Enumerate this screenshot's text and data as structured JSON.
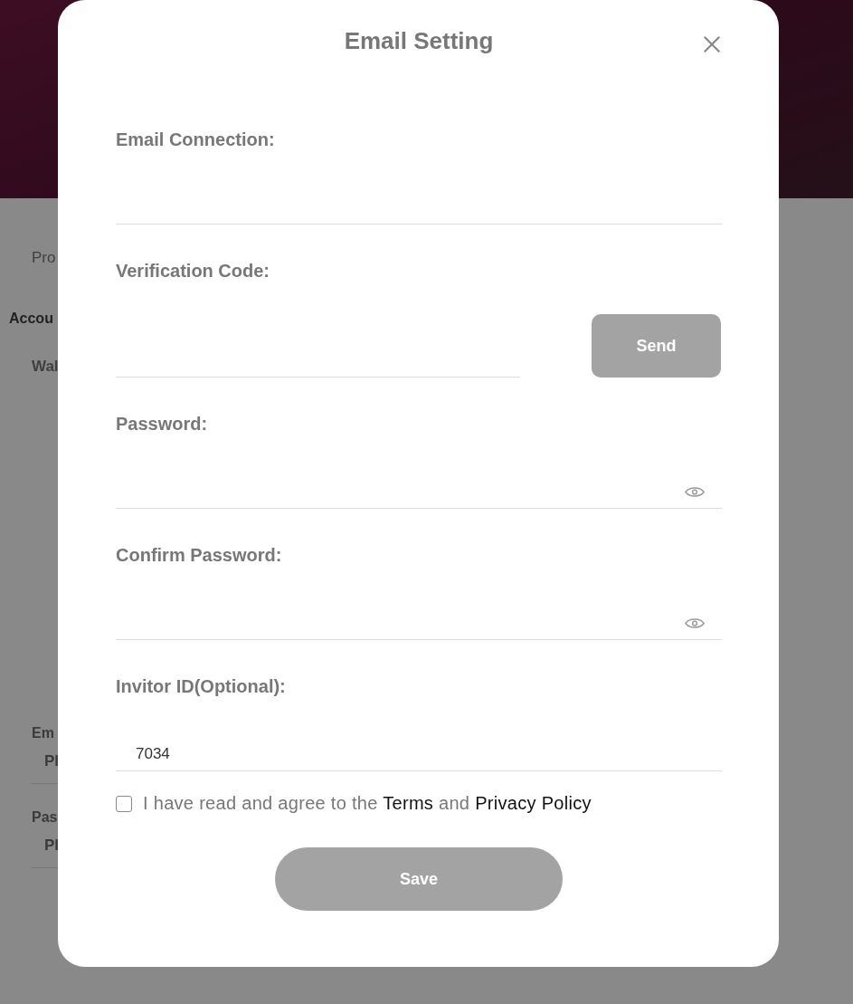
{
  "background_page": {
    "nav": [
      {
        "text": "Pro"
      }
    ],
    "section_title": "Accou",
    "menu": [
      {
        "text": "Wal"
      }
    ],
    "fields": [
      {
        "label": "Em",
        "placeholder": "Pl"
      },
      {
        "label": "Pas",
        "placeholder": "Pl"
      }
    ]
  },
  "dialog": {
    "title": "Email Setting",
    "fields": [
      {
        "kind": "text",
        "label": "Email Connection:"
      },
      {
        "kind": "code",
        "label": "Verification Code:",
        "button": "Send"
      },
      {
        "kind": "password",
        "label": "Password:"
      },
      {
        "kind": "password",
        "label": "Confirm Password:"
      },
      {
        "kind": "text",
        "label": "Invitor ID(Optional):",
        "value": "7034"
      }
    ],
    "agreement": {
      "checked": false,
      "parts": [
        {
          "kind": "text",
          "text": "I have read and agree to the"
        },
        {
          "kind": "link",
          "text": "Terms"
        },
        {
          "kind": "text",
          "text": "and"
        },
        {
          "kind": "link",
          "text": "Privacy Policy"
        }
      ]
    },
    "save_button": "Save"
  }
}
